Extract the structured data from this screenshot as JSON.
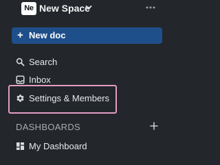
{
  "workspace": {
    "logo_text": "Ne",
    "name": "New Space"
  },
  "new_doc": {
    "plus": "+",
    "label": "New doc"
  },
  "nav": {
    "search": "Search",
    "inbox": "Inbox",
    "settings": "Settings & Members"
  },
  "dashboards": {
    "section_label": "DASHBOARDS",
    "items": [
      {
        "label": "My Dashboard",
        "icon": "dashboard-grid-icon"
      }
    ]
  },
  "colors": {
    "background": "#23272b",
    "primary_button": "#1f4f8a",
    "highlight_outline": "#e59cc6"
  }
}
